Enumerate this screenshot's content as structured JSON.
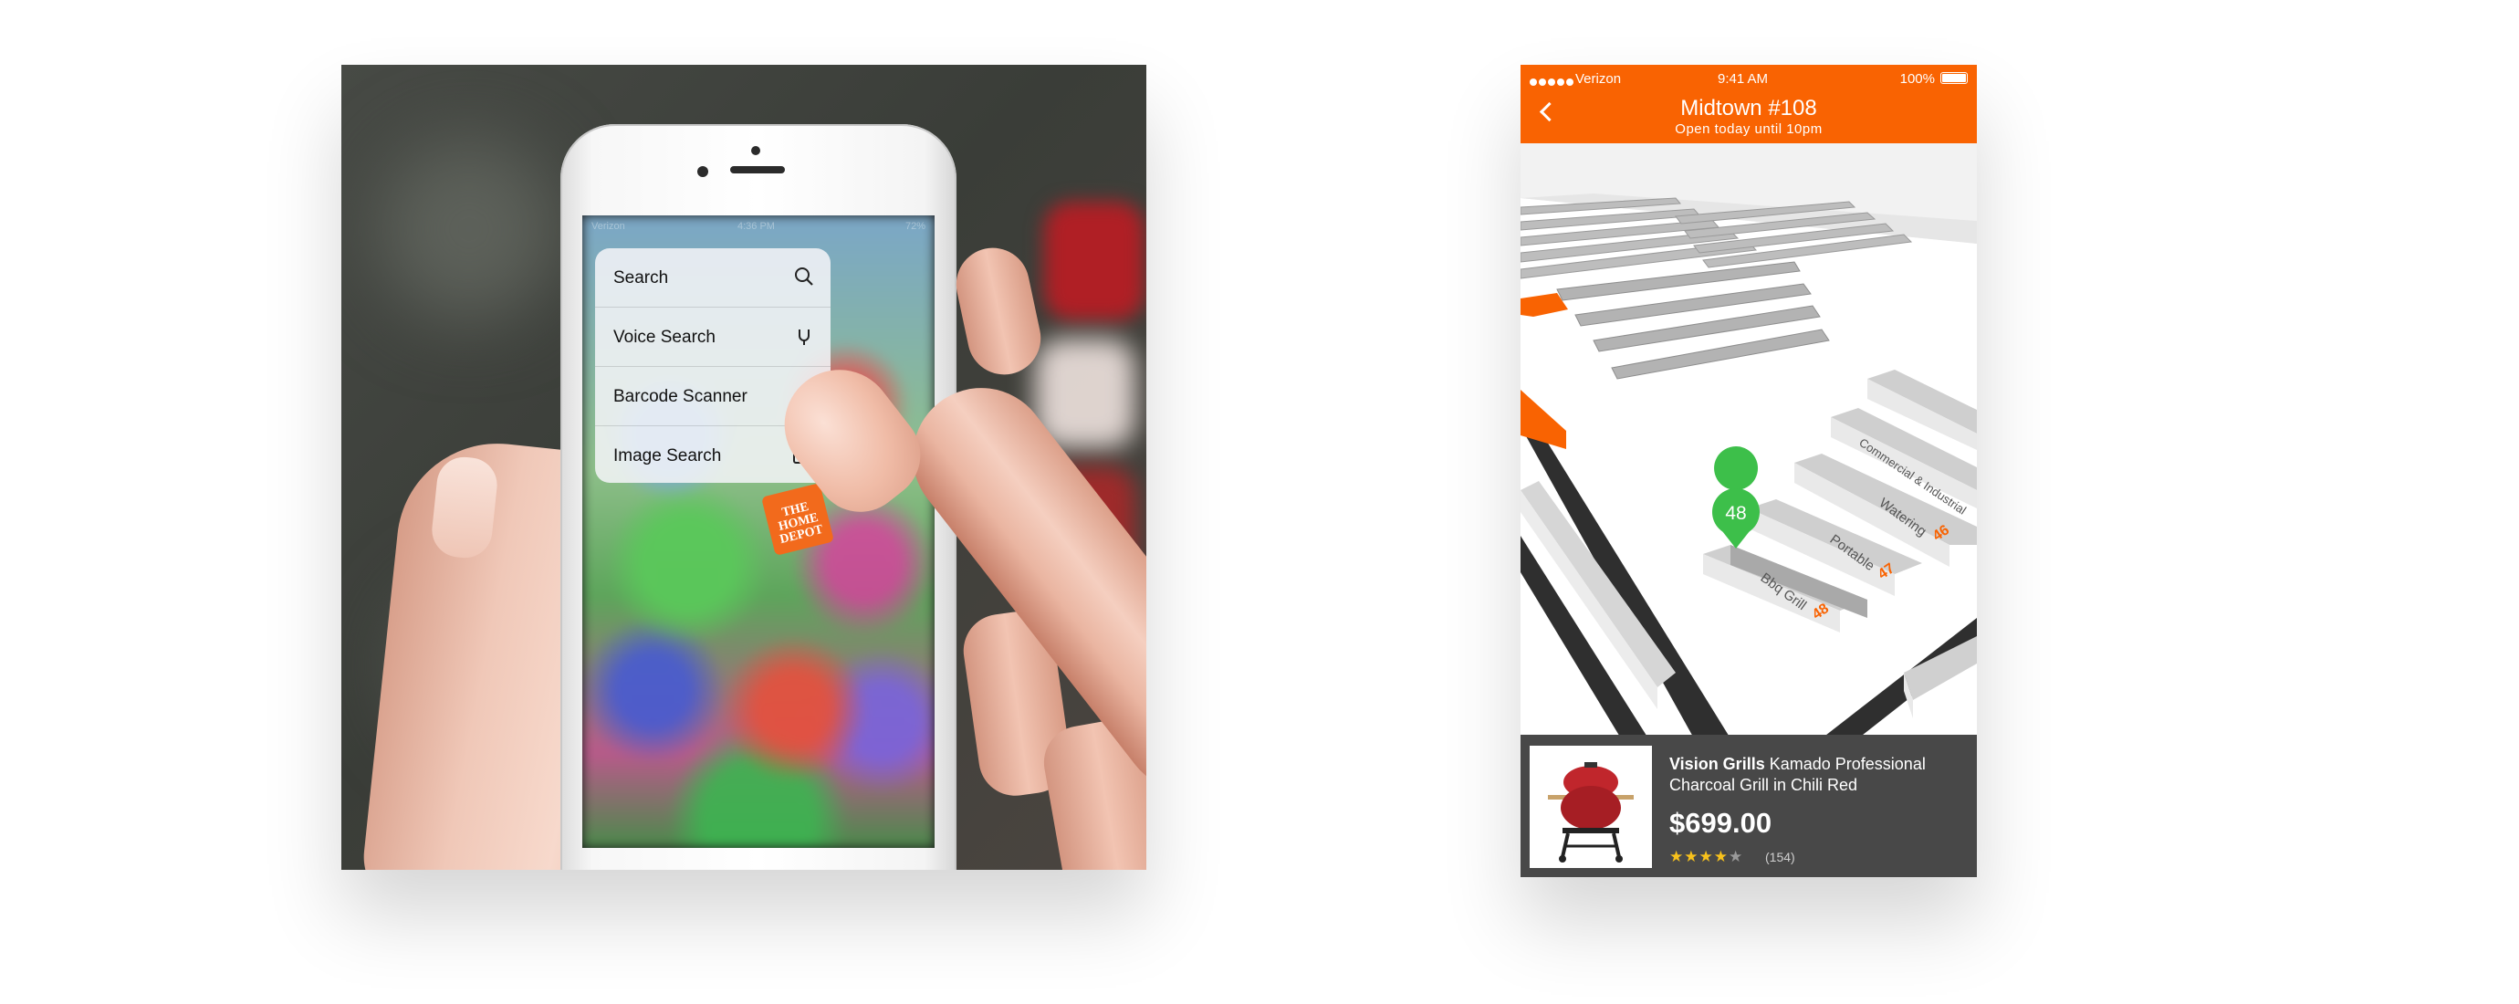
{
  "left_photo": {
    "status_bar": {
      "carrier": "Verizon",
      "time": "4:36 PM",
      "battery": "72%"
    },
    "quick_actions": [
      {
        "label": "Search",
        "icon": "search-icon"
      },
      {
        "label": "Voice Search",
        "icon": "microphone-icon"
      },
      {
        "label": "Barcode Scanner",
        "icon": ""
      },
      {
        "label": "Image Search",
        "icon": "camera-icon"
      }
    ],
    "app_icon_logo": "THE HOME DEPOT"
  },
  "app": {
    "status_bar": {
      "carrier": "Verizon",
      "time": "9:41 AM",
      "battery": "100%"
    },
    "nav": {
      "title": "Midtown #108",
      "subtitle": "Open today until 10pm"
    },
    "map": {
      "pin_label": "48",
      "aisles": [
        {
          "name": "Bbq Grill",
          "number": "48"
        },
        {
          "name": "Portable",
          "number": "47"
        },
        {
          "name": "Watering",
          "number": "46"
        },
        {
          "name": "Commercial & Industrial",
          "number": ""
        }
      ],
      "colors": {
        "aisle_number": "#f96302",
        "pin": "#3dbf4a"
      }
    },
    "product": {
      "brand": "Vision Grills",
      "name": "Kamado Professional Charcoal Grill in Chili Red",
      "price": "$699.00",
      "rating": 4,
      "max_rating": 5,
      "review_count": "(154)"
    },
    "colors": {
      "brand_orange": "#f96302",
      "product_bar": "#484848",
      "star": "#f8c21c"
    }
  }
}
